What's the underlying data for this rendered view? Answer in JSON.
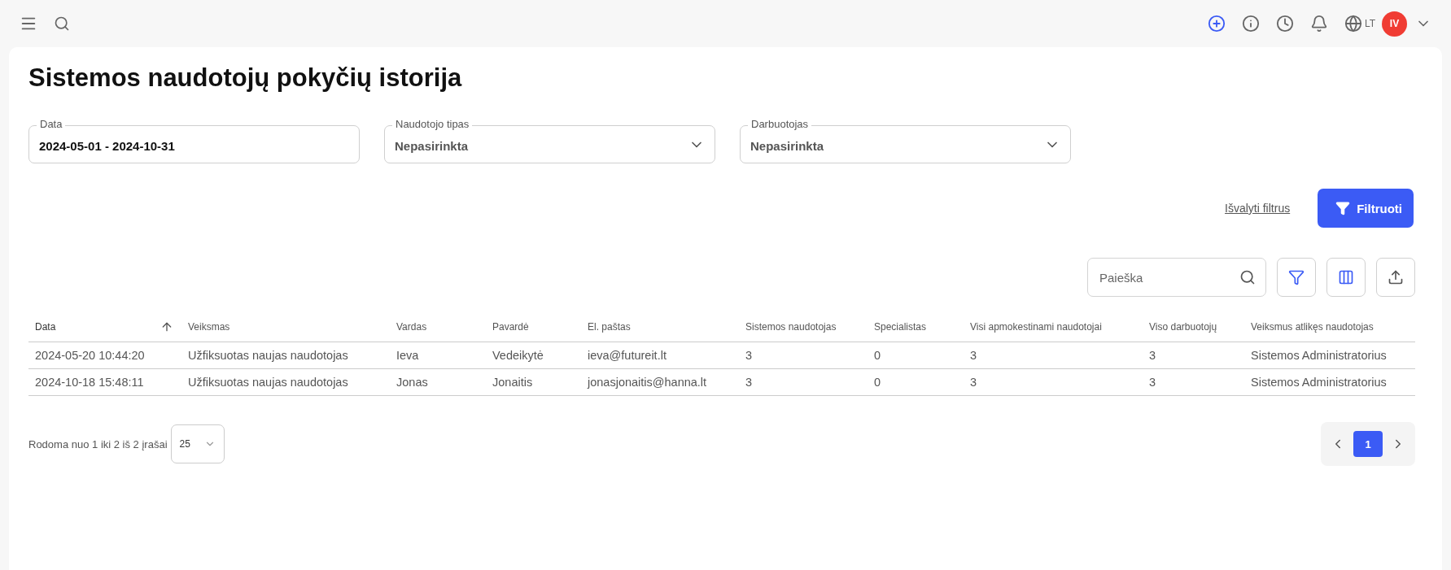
{
  "topbar": {
    "language": "LT",
    "avatar_initials": "IV"
  },
  "title": "Sistemos naudotojų pokyčių istorija",
  "filters": [
    {
      "kind": "text",
      "label": "Data",
      "value": "2024-05-01 - 2024-10-31"
    },
    {
      "kind": "select",
      "label": "Naudotojo tipas",
      "value": "Nepasirinkta"
    },
    {
      "kind": "select",
      "label": "Darbuotojas",
      "value": "Nepasirinkta"
    }
  ],
  "clear_link": "Išvalyti filtrus",
  "filter_button": "Filtruoti",
  "search": {
    "placeholder": "Paieška"
  },
  "table": {
    "columns": [
      {
        "label": "Data",
        "sorted": true
      },
      {
        "label": "Veiksmas",
        "sorted": false
      },
      {
        "label": "Vardas",
        "sorted": false
      },
      {
        "label": "Pavardė",
        "sorted": false
      },
      {
        "label": "El. paštas",
        "sorted": false
      },
      {
        "label": "Sistemos naudotojas",
        "sorted": false
      },
      {
        "label": "Specialistas",
        "sorted": false
      },
      {
        "label": "Visi apmokestinami naudotojai",
        "sorted": false
      },
      {
        "label": "Viso darbuotojų",
        "sorted": false
      },
      {
        "label": "Veiksmus atlikęs naudotojas",
        "sorted": false
      }
    ],
    "rows": [
      [
        "2024-05-20 10:44:20",
        "Užfiksuotas naujas naudotojas",
        "Ieva",
        "Vedeikytė",
        "ieva@futureit.lt",
        "3",
        "0",
        "3",
        "3",
        "Sistemos Administratorius"
      ],
      [
        "2024-10-18 15:48:11",
        "Užfiksuotas naujas naudotojas",
        "Jonas",
        "Jonaitis",
        "jonasjonaitis@hanna.lt",
        "3",
        "0",
        "3",
        "3",
        "Sistemos Administratorius"
      ]
    ]
  },
  "footer": {
    "summary": "Rodoma nuo 1 iki 2 iš 2 įrašai",
    "page_size": "25",
    "pages": [
      {
        "label": "1",
        "selected": true
      }
    ]
  }
}
